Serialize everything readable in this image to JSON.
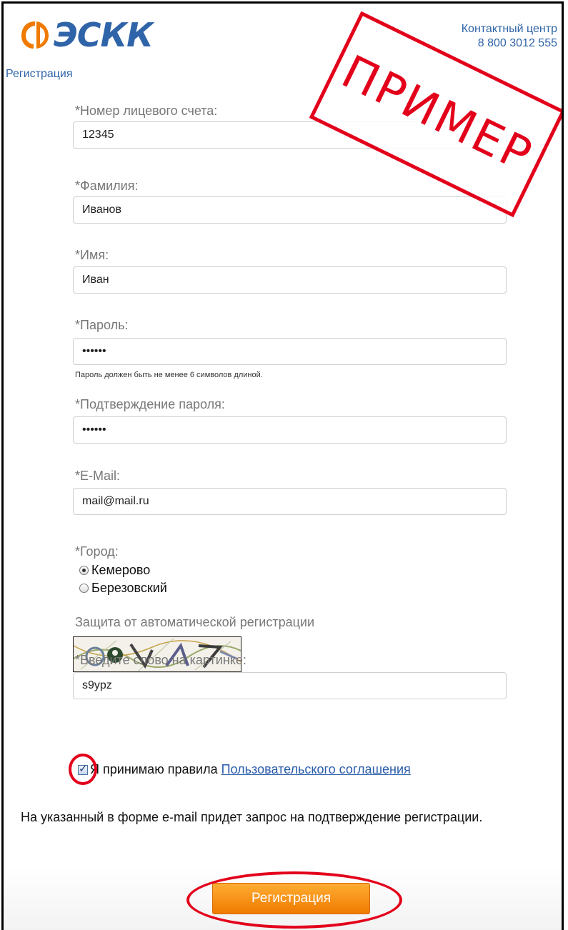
{
  "header": {
    "logo_text": "ЭСКК",
    "subtitle": "Регистрация",
    "contact_title": "Контактный центр",
    "contact_phone": "8 800 3012 555"
  },
  "stamp_text": "ПРИМЕР",
  "form": {
    "account": {
      "label": "*Номер лицевого счета:",
      "value": "12345"
    },
    "surname": {
      "label": "*Фамилия:",
      "value": "Иванов"
    },
    "name": {
      "label": "*Имя:",
      "value": "Иван"
    },
    "password": {
      "label": "*Пароль:",
      "value": "••••••",
      "hint": "Пароль должен быть не менее 6 символов длиной."
    },
    "password_confirm": {
      "label": "*Подтверждение пароля:",
      "value": "••••••"
    },
    "email": {
      "label": "*E-Mail:",
      "value": "mail@mail.ru"
    },
    "city": {
      "label": "*Город:",
      "options": [
        {
          "label": "Кемерово",
          "checked": true
        },
        {
          "label": "Березовский",
          "checked": false
        }
      ]
    },
    "captcha_title": "Защита от автоматической регистрации",
    "captcha_input": {
      "label": "*Введите слово на картинке:",
      "value": "s9ypz"
    },
    "agree": {
      "text": "Я принимаю правила",
      "link": "Пользовательского соглашения",
      "checked": true,
      "check_glyph": "✓"
    },
    "notice": "На указанный в форме e-mail придет запрос на подтверждение регистрации.",
    "submit_label": "Регистрация"
  },
  "colors": {
    "brand": "#2f64a8",
    "accent_orange": "#f07a00",
    "annotation_red": "#e3001b"
  }
}
